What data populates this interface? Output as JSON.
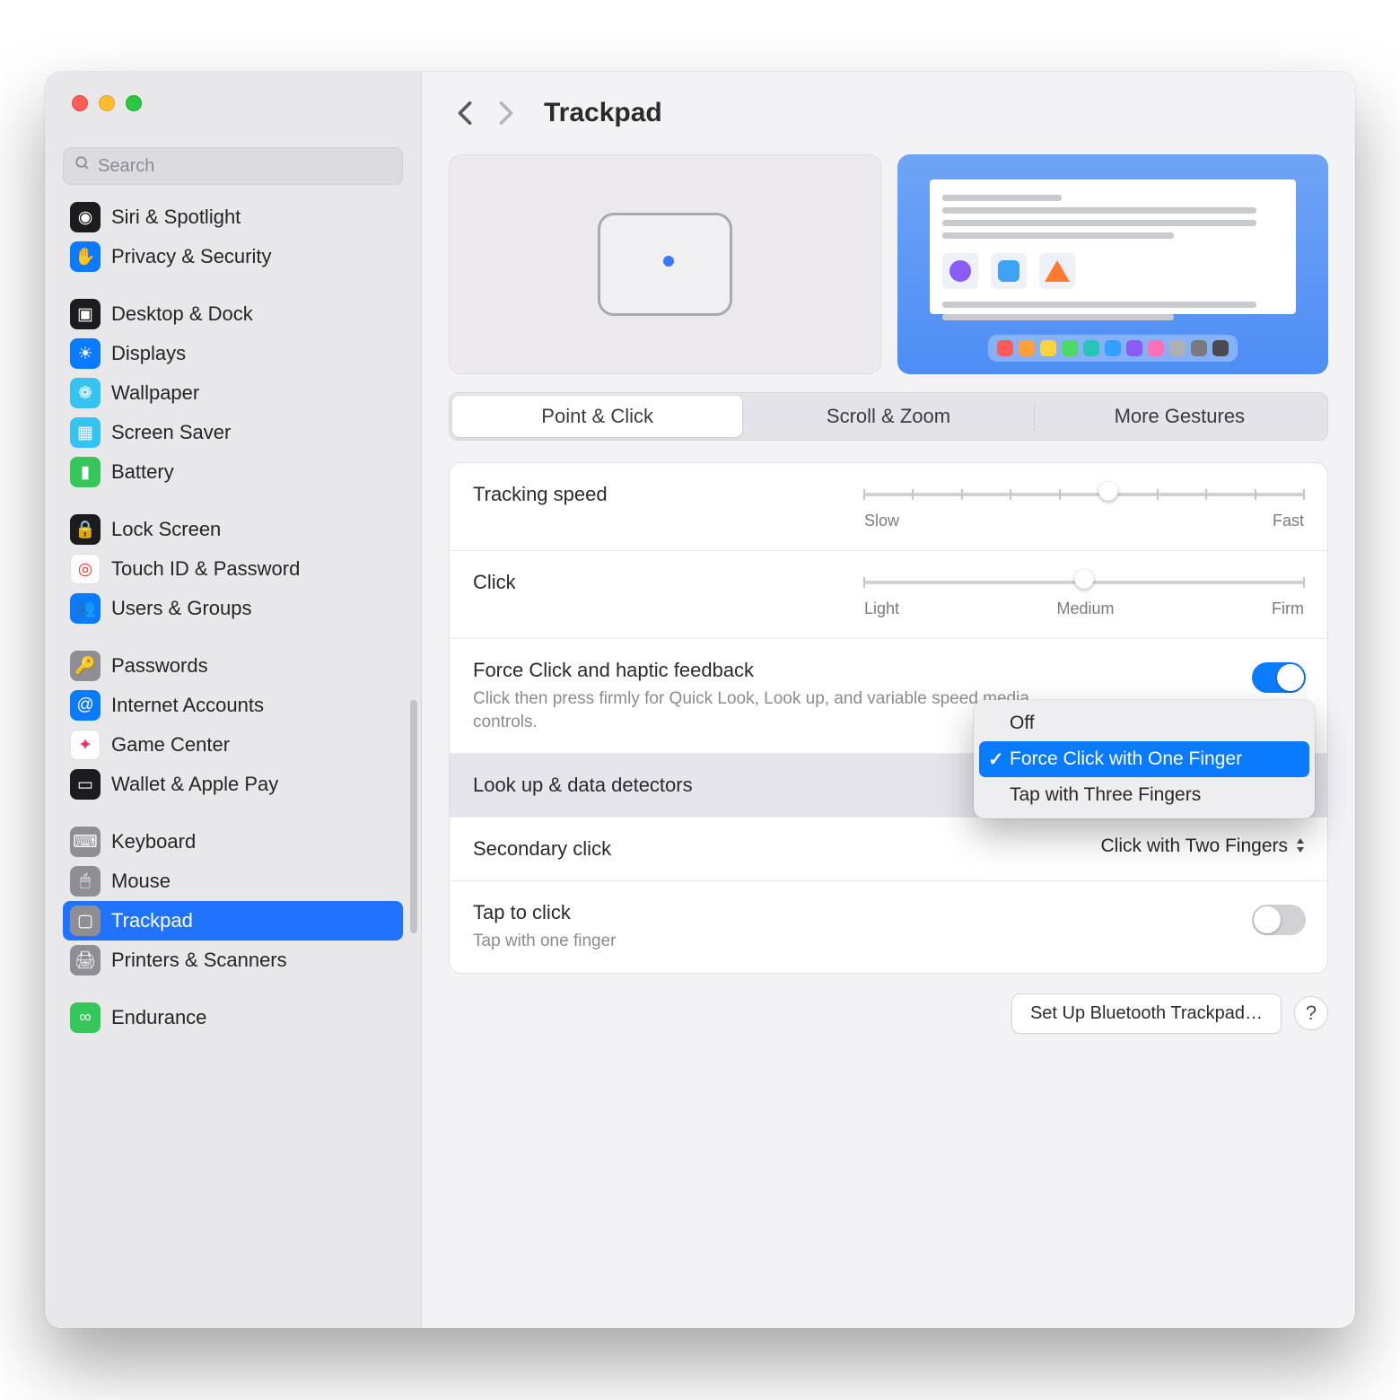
{
  "header": {
    "title": "Trackpad"
  },
  "search": {
    "placeholder": "Search"
  },
  "sidebar": {
    "groups": [
      {
        "items": [
          {
            "label": "Siri & Spotlight",
            "icon_bg": "#1c1c1e",
            "icon_glyph": "◉"
          },
          {
            "label": "Privacy & Security",
            "icon_bg": "#0a7aff",
            "icon_glyph": "✋"
          }
        ]
      },
      {
        "items": [
          {
            "label": "Desktop & Dock",
            "icon_bg": "#1c1c1e",
            "icon_glyph": "▣"
          },
          {
            "label": "Displays",
            "icon_bg": "#0a7aff",
            "icon_glyph": "☀"
          },
          {
            "label": "Wallpaper",
            "icon_bg": "#35c3f0",
            "icon_glyph": "❁"
          },
          {
            "label": "Screen Saver",
            "icon_bg": "#35c3f0",
            "icon_glyph": "▦"
          },
          {
            "label": "Battery",
            "icon_bg": "#34c759",
            "icon_glyph": "▮"
          }
        ]
      },
      {
        "items": [
          {
            "label": "Lock Screen",
            "icon_bg": "#1c1c1e",
            "icon_glyph": "🔒"
          },
          {
            "label": "Touch ID & Password",
            "icon_bg": "#ffffff",
            "icon_glyph": "◎",
            "fg": "#ff3b30"
          },
          {
            "label": "Users & Groups",
            "icon_bg": "#0a7aff",
            "icon_glyph": "👥"
          }
        ]
      },
      {
        "items": [
          {
            "label": "Passwords",
            "icon_bg": "#8e8e93",
            "icon_glyph": "🔑"
          },
          {
            "label": "Internet Accounts",
            "icon_bg": "#0a7aff",
            "icon_glyph": "@"
          },
          {
            "label": "Game Center",
            "icon_bg": "#ffffff",
            "icon_glyph": "✦",
            "fg": "#ff2d55"
          },
          {
            "label": "Wallet & Apple Pay",
            "icon_bg": "#1c1c1e",
            "icon_glyph": "▭"
          }
        ]
      },
      {
        "items": [
          {
            "label": "Keyboard",
            "icon_bg": "#8e8e93",
            "icon_glyph": "⌨"
          },
          {
            "label": "Mouse",
            "icon_bg": "#8e8e93",
            "icon_glyph": "🖱"
          },
          {
            "label": "Trackpad",
            "icon_bg": "#8e8e93",
            "icon_glyph": "▢",
            "selected": true
          },
          {
            "label": "Printers & Scanners",
            "icon_bg": "#8e8e93",
            "icon_glyph": "🖨"
          }
        ]
      },
      {
        "items": [
          {
            "label": "Endurance",
            "icon_bg": "#34c759",
            "icon_glyph": "∞"
          }
        ]
      }
    ]
  },
  "tabs": {
    "items": [
      "Point & Click",
      "Scroll & Zoom",
      "More Gestures"
    ],
    "active_index": 0
  },
  "settings": {
    "tracking": {
      "label": "Tracking speed",
      "min_label": "Slow",
      "max_label": "Fast",
      "ticks": 10,
      "value_index": 5
    },
    "click": {
      "label": "Click",
      "labels": [
        "Light",
        "Medium",
        "Firm"
      ],
      "ticks": 3,
      "value_index": 1
    },
    "force_click": {
      "label": "Force Click and haptic feedback",
      "description": "Click then press firmly for Quick Look, Look up, and variable speed media controls.",
      "enabled": true
    },
    "lookup": {
      "label": "Look up & data detectors",
      "options": [
        "Off",
        "Force Click with One Finger",
        "Tap with Three Fingers"
      ],
      "selected_index": 1
    },
    "secondary": {
      "label": "Secondary click",
      "value": "Click with Two Fingers"
    },
    "tap": {
      "label": "Tap to click",
      "description": "Tap with one finger",
      "enabled": false
    }
  },
  "footer": {
    "button": "Set Up Bluetooth Trackpad…",
    "help": "?"
  }
}
